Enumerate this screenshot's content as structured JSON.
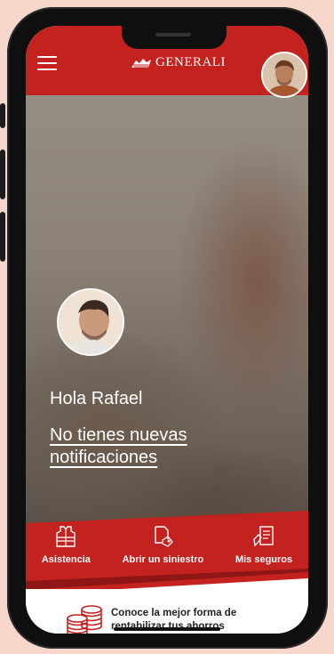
{
  "header": {
    "logo_text": "GENERALI",
    "menu_icon": "hamburger-menu-icon",
    "accent_color": "#c4221f"
  },
  "hero": {
    "greeting": "Hola Rafael",
    "notification_text": "No tienes nuevas notificaciones"
  },
  "actions": [
    {
      "label": "Asistencia",
      "icon": "vest-icon"
    },
    {
      "label": "Abrir un siniestro",
      "icon": "claim-document-icon"
    },
    {
      "label": "Mis seguros",
      "icon": "policy-document-icon"
    }
  ],
  "promo": {
    "text": "Conoce la mejor forma de rentabilizar tus ahorros",
    "icon": "coins-stack-icon"
  }
}
